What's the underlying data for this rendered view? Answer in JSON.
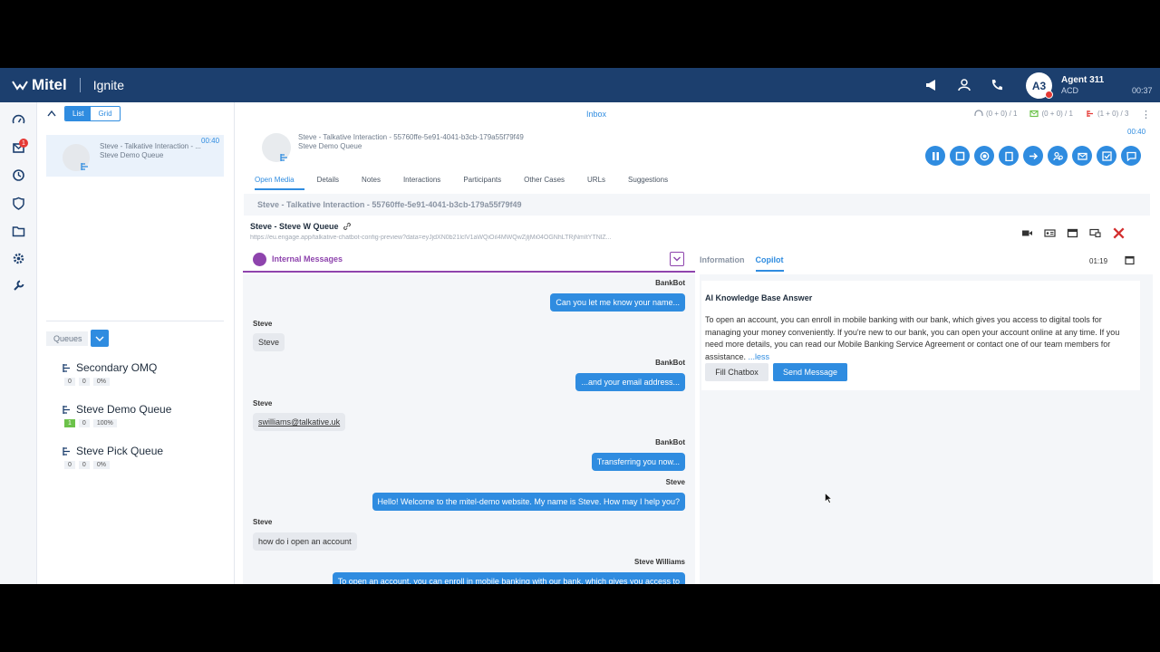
{
  "topbar": {
    "brand": "Mitel",
    "app_name": "Ignite",
    "agent_initials": "A3",
    "agent_name": "Agent 311",
    "agent_mode": "ACD",
    "agent_time": "00:37"
  },
  "rail": {
    "badge": "1"
  },
  "inbox": {
    "toggle_list": "List",
    "toggle_grid": "Grid",
    "card_line1": "Steve - Talkative Interaction - ...",
    "card_line2": "Steve Demo Queue",
    "card_time": "00:40",
    "queues_label": "Queues",
    "queues": [
      {
        "name": "Secondary OMQ",
        "s1": "0",
        "s2": "0",
        "s3": "0%"
      },
      {
        "name": "Steve Demo Queue",
        "s1": "1",
        "s2": "0",
        "s3": "100%"
      },
      {
        "name": "Steve Pick Queue",
        "s1": "0",
        "s2": "0",
        "s3": "0%"
      }
    ]
  },
  "main": {
    "title": "Inbox",
    "counter_voice": "(0 + 0) / 1",
    "counter_email": "(0 + 0) / 1",
    "counter_chat": "(1 + 0) / 3",
    "timer": "00:40",
    "header_line1": "Steve - Talkative Interaction - 55760ffe-5e91-4041-b3cb-179a55f79f49",
    "header_line2": "Steve Demo Queue",
    "tabs": [
      "Open Media",
      "Details",
      "Notes",
      "Interactions",
      "Participants",
      "Other Cases",
      "URLs",
      "Suggestions"
    ],
    "subtitle": "Steve - Talkative Interaction - 55760ffe-5e91-4041-b3cb-179a55f79f49",
    "conv_name": "Steve - Steve W Queue",
    "conv_url": "https://eu.engage.app/talkative-chatbot-config-preview?data=eyJjdXN0b21lclV1aWQiOiI4MWQwZjljMi04OGNhLTRjNmItYTNlZ..."
  },
  "chat": {
    "header_label": "Internal Messages",
    "messages": {
      "m1_sender": "BankBot",
      "m1_text": "Can you let me know your name...",
      "m2_sender": "Steve",
      "m2_text": "Steve",
      "m3_sender": "BankBot",
      "m3_text": "...and your email address...",
      "m4_sender": "Steve",
      "m4_text": "swilliams@talkative.uk",
      "m5_sender": "BankBot",
      "m5_text": "Transferring you now...",
      "m6_sender": "Steve",
      "m6_text": "Hello! Welcome to the mitel-demo website. My name is Steve. How may I help you?",
      "m7_sender": "Steve",
      "m7_text": "how do i open an account",
      "m8_sender": "Steve Williams",
      "m8_text": "To open an account, you can enroll in mobile banking with our bank, which gives you access to"
    }
  },
  "info": {
    "tab_information": "Information",
    "tab_copilot": "Copilot",
    "timer": "01:19",
    "kb_title": "AI Knowledge Base Answer",
    "kb_text": "To open an account, you can enroll in mobile banking with our bank, which gives you access to digital tools for managing your money conveniently. If you're new to our bank, you can open your account online at any time. If you need more details, you can read our Mobile Banking Service Agreement or contact one of our team members for assistance.",
    "kb_less": " ...less",
    "fill_label": "Fill Chatbox",
    "send_label": "Send Message"
  }
}
